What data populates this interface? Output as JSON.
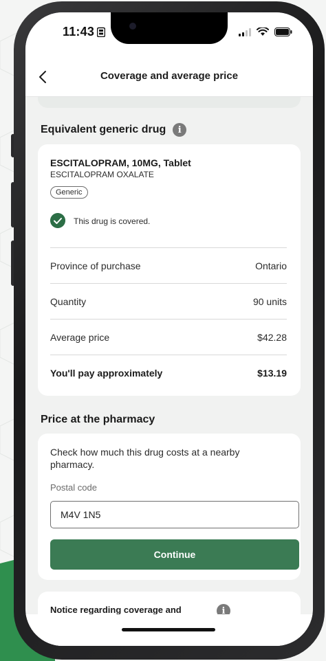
{
  "status_bar": {
    "time": "11:43"
  },
  "nav": {
    "title": "Coverage and average price"
  },
  "generic_section": {
    "heading": "Equivalent generic drug",
    "drug_name": "ESCITALOPRAM, 10MG, Tablet",
    "drug_sub": "ESCITALOPRAM OXALATE",
    "badge": "Generic",
    "covered_text": "This drug is covered.",
    "rows": [
      {
        "label": "Province of purchase",
        "value": "Ontario"
      },
      {
        "label": "Quantity",
        "value": "90 units"
      },
      {
        "label": "Average price",
        "value": "$42.28"
      },
      {
        "label": "You'll pay approximately",
        "value": "$13.19"
      }
    ]
  },
  "pharmacy_section": {
    "heading": "Price at the pharmacy",
    "description": "Check how much this drug costs at a nearby pharmacy.",
    "postal_label": "Postal code",
    "postal_value": "M4V 1N5",
    "continue_label": "Continue"
  },
  "notice": {
    "text": "Notice regarding coverage and displayed price"
  },
  "colors": {
    "accent": "#3b7b54",
    "check": "#2c6e46"
  }
}
